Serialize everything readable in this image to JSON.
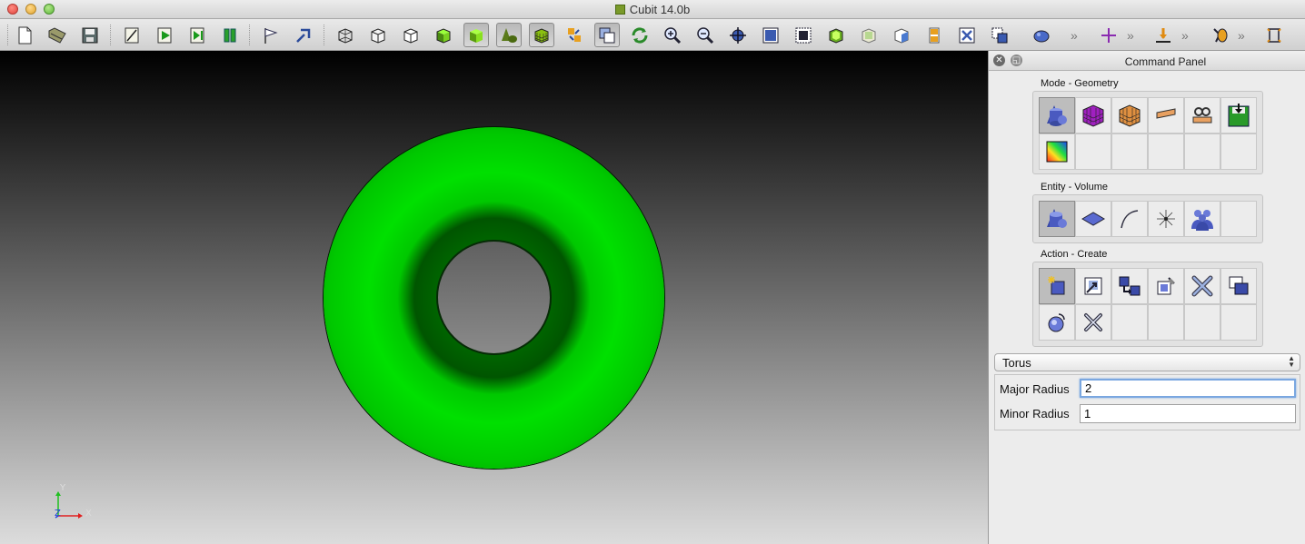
{
  "window": {
    "title": "Cubit 14.0b"
  },
  "toolbar": {
    "buttons": [
      "new-file",
      "open-file",
      "save-file",
      "journal-edit",
      "play-journal",
      "play-step",
      "pause",
      "flag",
      "undo",
      "view-wireframe",
      "view-hidden",
      "view-shaded-outline",
      "view-shaded",
      "view-smooth",
      "view-geometry",
      "view-mesh",
      "view-transparent",
      "select-box",
      "refresh",
      "zoom-in",
      "zoom-out",
      "center",
      "fit-screen",
      "fit-selected",
      "view-iso",
      "view-top",
      "view-front",
      "view-side",
      "zoom-window",
      "rubberband",
      "navigate"
    ],
    "more_glyph": "»"
  },
  "viewport": {
    "triad": {
      "y_label": "Y",
      "x_label": "X",
      "z_label": "Z"
    }
  },
  "panel": {
    "title": "Command Panel",
    "mode_label": "Mode - Geometry",
    "entity_label": "Entity - Volume",
    "action_label": "Action - Create",
    "mode_icons": [
      "geometry-icon",
      "mesh-icon",
      "mesh-quality-icon",
      "boundary-icon",
      "material-icon",
      "export-icon",
      "analysis-icon"
    ],
    "entity_icons": [
      "volume-icon",
      "surface-icon",
      "curve-icon",
      "vertex-icon",
      "group-icon"
    ],
    "action_icons": [
      "create-icon",
      "transform-icon",
      "copy-icon",
      "modify-icon",
      "delete-icon",
      "boolean-icon",
      "webcut-icon",
      "cleanup-icon"
    ],
    "shape_select": "Torus",
    "fields": [
      {
        "label": "Major Radius",
        "value": "2"
      },
      {
        "label": "Minor Radius",
        "value": "1"
      }
    ]
  },
  "colors": {
    "torus": "#00d000",
    "active_cell": "#bdbdbd",
    "focus": "#7aa7e0"
  }
}
